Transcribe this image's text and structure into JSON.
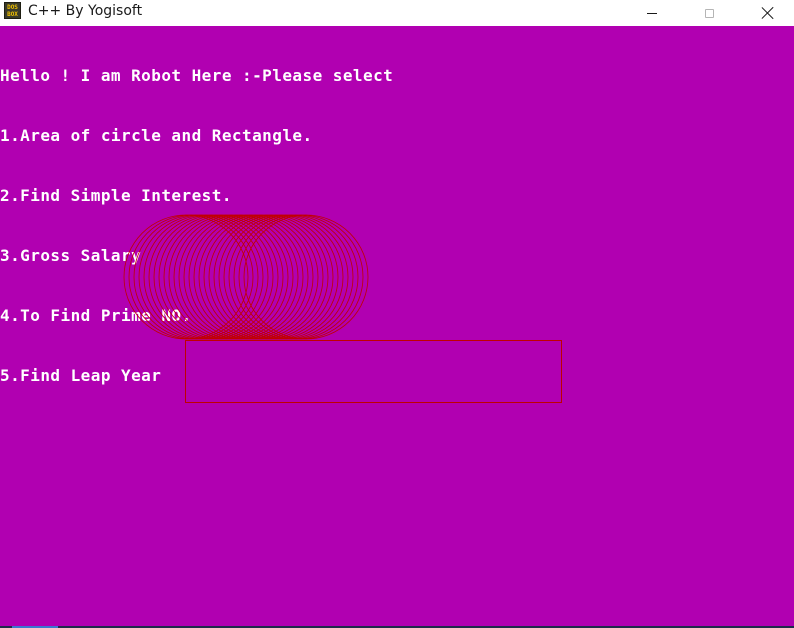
{
  "window": {
    "title": "C++ By Yogisoft",
    "icon_lines": [
      "DOS",
      "BOX"
    ],
    "controls": {
      "minimize": "minimize-icon",
      "maximize": "maximize-icon",
      "close": "close-icon"
    }
  },
  "console": {
    "background": "#b100b1",
    "text_color": "#ffffff",
    "graphics_color": "#c00000",
    "lines": [
      "Hello ! I am Robot Here :-Please select",
      "1.Area of circle and Rectangle.",
      "2.Find Simple Interest.",
      "3.Gross Salary",
      "4.To Find Prime NO.",
      "5.Find Leap Year"
    ]
  }
}
